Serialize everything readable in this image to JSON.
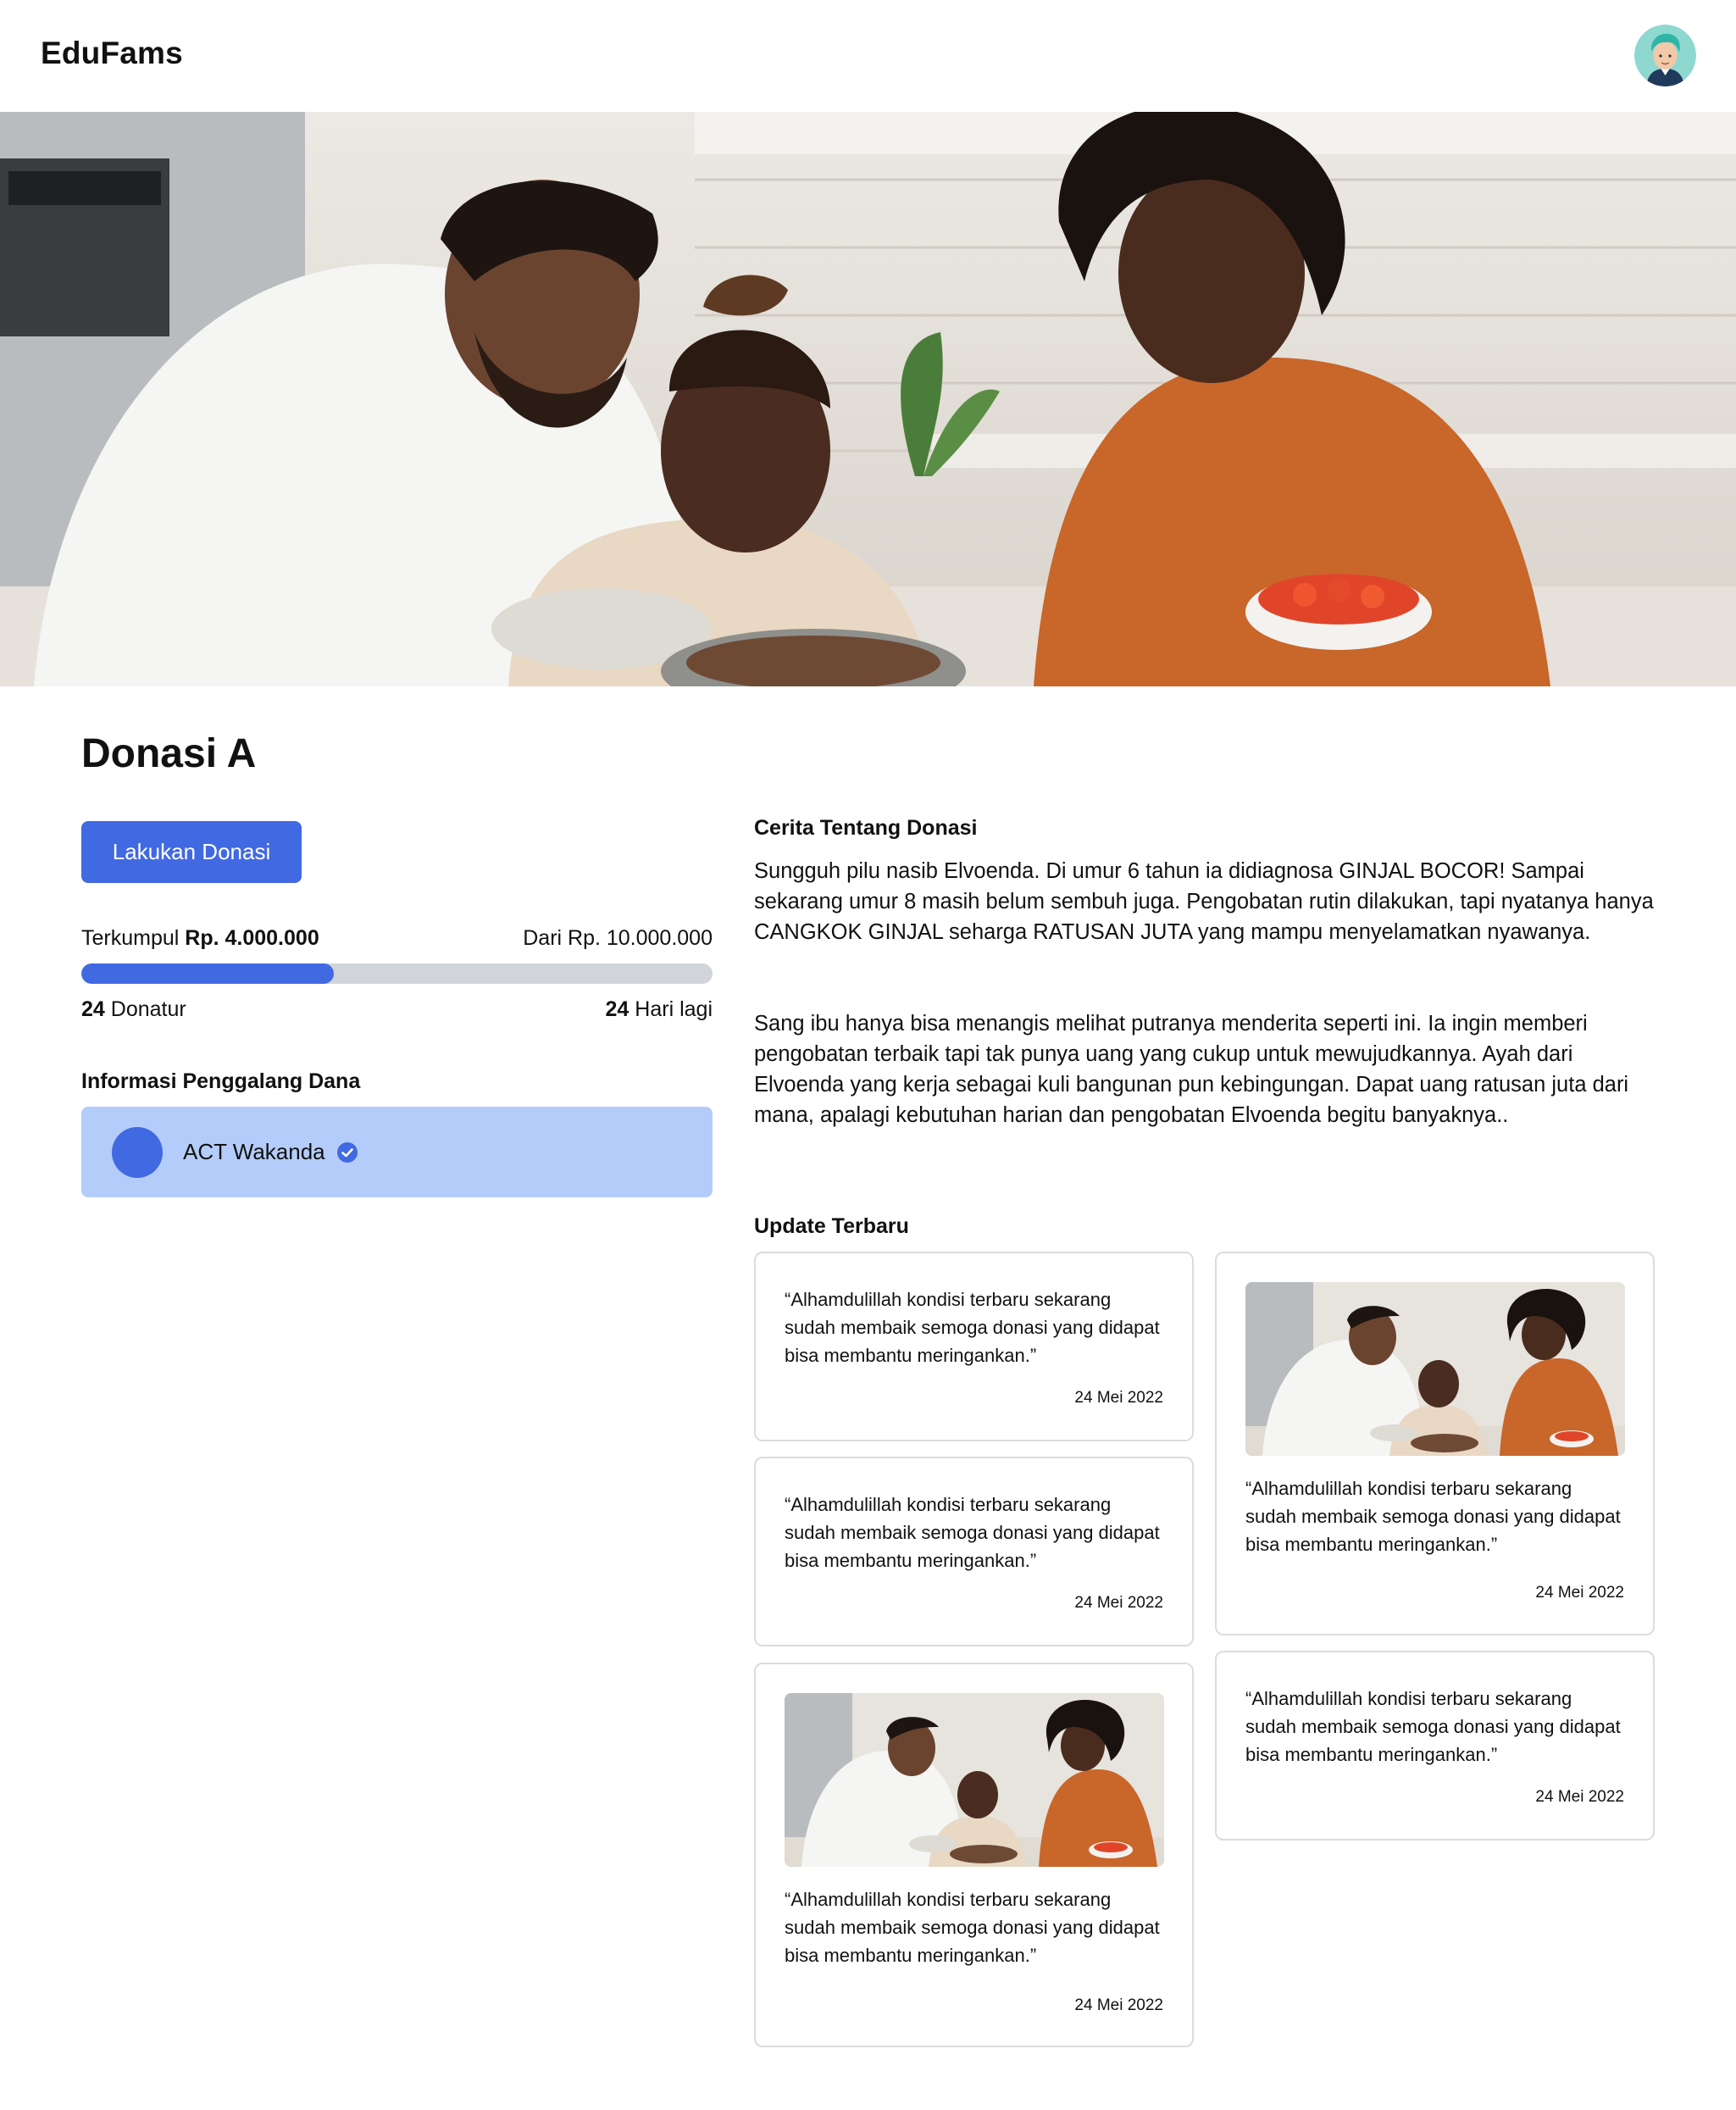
{
  "header": {
    "app_name": "EduFams",
    "avatar_icon": "user-avatar-icon"
  },
  "hero": {
    "image": "family-cooking-photo"
  },
  "page": {
    "title": "Donasi A"
  },
  "donation": {
    "button_label": "Lakukan Donasi",
    "collected_label": "Terkumpul",
    "collected_amount": "Rp. 4.000.000",
    "target_text": "Dari Rp. 10.000.000",
    "progress_fraction": 0.4,
    "donor_count": "24",
    "donor_label": "Donatur",
    "days_count": "24",
    "days_label": "Hari lagi"
  },
  "fundraiser": {
    "heading": "Informasi Penggalang Dana",
    "name": "ACT Wakanda",
    "verified_icon": "verified-check-icon"
  },
  "story": {
    "heading": "Cerita Tentang Donasi",
    "paragraphs": [
      "Sungguh pilu nasib Elvoenda. Di umur 6 tahun ia didiagnosa GINJAL BOCOR! Sampai sekarang umur 8 masih belum sembuh juga. Pengobatan rutin dilakukan, tapi nyatanya hanya CANGKOK GINJAL seharga RATUSAN JUTA yang mampu menyelamatkan nyawanya.",
      "Sang ibu hanya bisa menangis melihat putranya menderita seperti ini. Ia ingin memberi pengobatan terbaik tapi tak punya uang yang cukup untuk mewujudkannya. Ayah dari Elvoenda yang kerja sebagai kuli bangunan pun kebingungan. Dapat uang ratusan juta dari mana, apalagi kebutuhan harian dan pengobatan Elvoenda begitu banyaknya.."
    ]
  },
  "updates": {
    "heading": "Update Terbaru",
    "items": [
      {
        "quote": "“Alhamdulillah kondisi terbaru sekarang sudah membaik semoga donasi yang didapat bisa membantu meringankan.”",
        "date": "24 Mei 2022"
      },
      {
        "quote": "“Alhamdulillah kondisi terbaru sekarang sudah membaik semoga donasi yang didapat bisa membantu meringankan.”",
        "date": "24 Mei 2022"
      },
      {
        "quote": "“Alhamdulillah kondisi terbaru sekarang sudah membaik semoga donasi yang didapat bisa membantu meringankan.”",
        "date": "24 Mei 2022"
      },
      {
        "quote": "“Alhamdulillah kondisi terbaru sekarang sudah membaik semoga donasi yang didapat bisa membantu meringankan.”",
        "date": "24 Mei 2022"
      },
      {
        "quote": "“Alhamdulillah kondisi terbaru sekarang sudah membaik semoga donasi yang didapat bisa membantu meringankan.”",
        "date": "24 Mei 2022"
      }
    ]
  },
  "colors": {
    "accent": "#4169e1",
    "track": "#d1d5db",
    "org_card": "#b4ccf9"
  }
}
